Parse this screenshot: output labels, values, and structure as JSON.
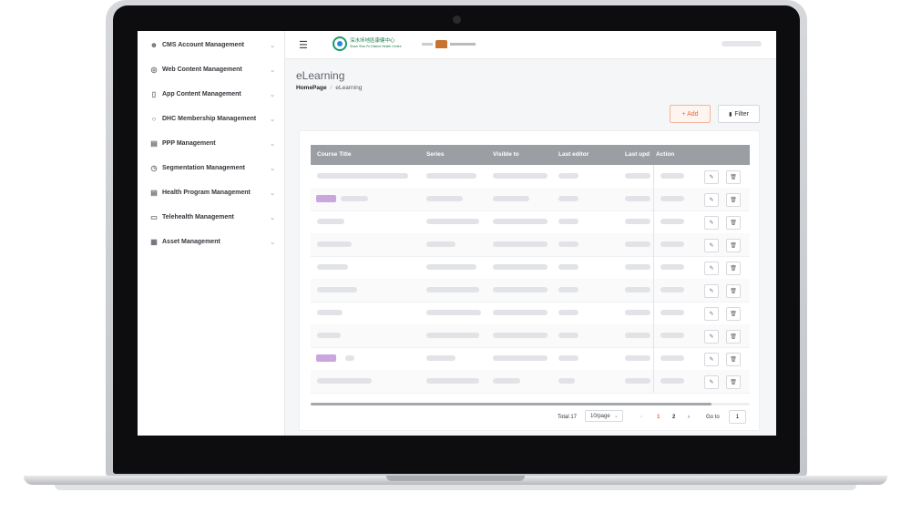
{
  "sidebar": {
    "items": [
      {
        "label": "CMS Account Management",
        "icon": "user-icon"
      },
      {
        "label": "Web Content Management",
        "icon": "globe-icon"
      },
      {
        "label": "App Content Management",
        "icon": "mobile-icon"
      },
      {
        "label": "DHC Membership Management",
        "icon": "person-icon"
      },
      {
        "label": "PPP Management",
        "icon": "card-icon"
      },
      {
        "label": "Segmentation Management",
        "icon": "clock-icon"
      },
      {
        "label": "Health Program Management",
        "icon": "card-icon"
      },
      {
        "label": "Telehealth Management",
        "icon": "monitor-icon"
      },
      {
        "label": "Asset Management",
        "icon": "image-icon"
      }
    ]
  },
  "header": {
    "logo_text_zh": "深水埗地區康健中心",
    "logo_text_en": "Sham Shui Po District Health Centre"
  },
  "page": {
    "title": "eLearning",
    "breadcrumb_home": "HomePage",
    "breadcrumb_current": "eLearning",
    "add_label": "+ Add",
    "filter_label": "Filter"
  },
  "table": {
    "columns": [
      "Course Title",
      "Series",
      "Visible to",
      "Last editor",
      "Last upd",
      "Action"
    ],
    "rows": 10
  },
  "pagination": {
    "total": "Total 17",
    "page_size": "10/page",
    "page1": "1",
    "page2": "2",
    "goto_label": "Go to",
    "goto_value": "1"
  },
  "colors": {
    "accent": "#e36a3c",
    "header_bg": "#9b9ea3",
    "tag": "#c9a6dc"
  }
}
